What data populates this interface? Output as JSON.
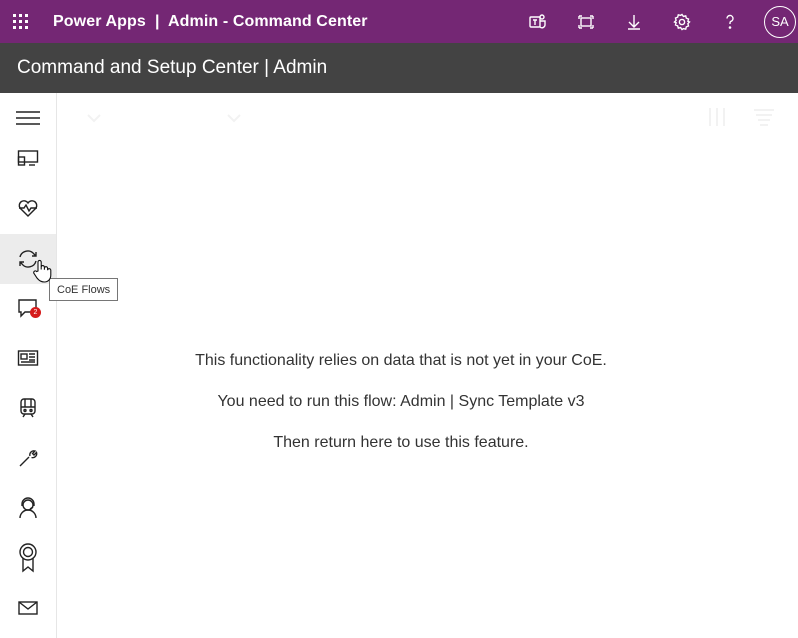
{
  "topbar": {
    "app_title": "Power Apps  |  Admin - Command Center",
    "icons": [
      "waffle-icon",
      "teams-icon",
      "fit-screen-icon",
      "download-icon",
      "settings-icon",
      "help-icon"
    ],
    "avatar_initials": "SA",
    "color": "#742774"
  },
  "appbar": {
    "title": "Command and Setup Center | Admin",
    "color": "#434343"
  },
  "leftnav": {
    "items": [
      {
        "icon": "hamburger-icon"
      },
      {
        "icon": "monitor-icon"
      },
      {
        "icon": "heart-pulse-icon"
      },
      {
        "icon": "sync-icon",
        "active": true,
        "tooltip": "CoE Flows"
      },
      {
        "icon": "chat-icon",
        "badge": "2"
      },
      {
        "icon": "news-icon"
      },
      {
        "icon": "train-icon"
      },
      {
        "icon": "wrench-icon"
      },
      {
        "icon": "support-person-icon"
      },
      {
        "icon": "award-ribbon-icon"
      },
      {
        "icon": "mail-icon"
      }
    ]
  },
  "message": {
    "line1": "This functionality relies on data that is not yet in your CoE.",
    "line2": "You need to run this flow: Admin | Sync Template v3",
    "line3": "Then return here to use this feature."
  }
}
